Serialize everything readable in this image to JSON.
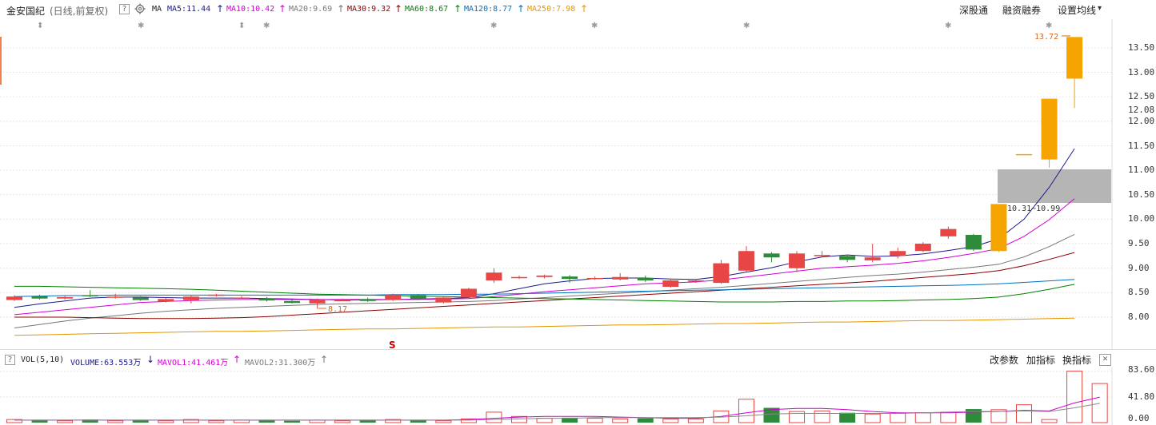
{
  "header": {
    "stock_name": "金安国纪",
    "period_label": "(日线,前复权)",
    "help_icon": "?",
    "settings_icon": "gear-icon",
    "ma_label": "MA",
    "ma_items": [
      {
        "label": "MA5:11.44",
        "arrow": "↑",
        "color": "#1a1a8c"
      },
      {
        "label": "MA10:10.42",
        "arrow": "↑",
        "color": "#d100d1"
      },
      {
        "label": "MA20:9.69",
        "arrow": "↑",
        "color": "#777777"
      },
      {
        "label": "MA30:9.32",
        "arrow": "↑",
        "color": "#8b0000"
      },
      {
        "label": "MA60:8.67",
        "arrow": "↑",
        "color": "#008000"
      },
      {
        "label": "MA120:8.77",
        "arrow": "↑",
        "color": "#0070c0"
      },
      {
        "label": "MA250:7.98",
        "arrow": "↑",
        "color": "#e69500"
      }
    ],
    "buttons": [
      "深股通",
      "融资融券",
      "设置均线"
    ],
    "settings_dropdown_arrow": "▾"
  },
  "price_axis": {
    "ticks": [
      "13.50",
      "13.00",
      "12.50",
      "12.00",
      "11.50",
      "11.00",
      "10.50",
      "10.00",
      "9.50",
      "9.00",
      "8.50",
      "8.00"
    ],
    "current": "12.08"
  },
  "annotations": {
    "high_label": "13.72",
    "low_label": "8.17",
    "gap_label": "10.31~10.99",
    "s_marker": "S"
  },
  "volume_header": {
    "help_icon": "?",
    "vol_label": "VOL(5,10)",
    "volume_value": "VOLUME:63.553万",
    "volume_arrow": "↓",
    "mavol1": "MAVOL1:41.461万",
    "mavol1_arrow": "↑",
    "mavol2": "MAVOL2:31.300万",
    "mavol2_arrow": "↑",
    "buttons": [
      "改参数",
      "加指标",
      "换指标"
    ],
    "close_icon": "✕"
  },
  "volume_axis": {
    "ticks": [
      "83.60",
      "41.80",
      "0.00"
    ]
  },
  "chart_data": {
    "type": "candlestick",
    "price_range": [
      7.6,
      13.9
    ],
    "candles": [
      {
        "o": 8.35,
        "c": 8.42,
        "h": 8.45,
        "l": 8.33
      },
      {
        "o": 8.43,
        "c": 8.38,
        "h": 8.46,
        "l": 8.36
      },
      {
        "o": 8.38,
        "c": 8.41,
        "h": 8.43,
        "l": 8.36
      },
      {
        "o": 8.45,
        "c": 8.43,
        "h": 8.55,
        "l": 8.41
      },
      {
        "o": 8.42,
        "c": 8.42,
        "h": 8.48,
        "l": 8.38
      },
      {
        "o": 8.4,
        "c": 8.35,
        "h": 8.43,
        "l": 8.33
      },
      {
        "o": 8.32,
        "c": 8.37,
        "h": 8.4,
        "l": 8.3
      },
      {
        "o": 8.35,
        "c": 8.42,
        "h": 8.44,
        "l": 8.28
      },
      {
        "o": 8.44,
        "c": 8.46,
        "h": 8.48,
        "l": 8.42
      },
      {
        "o": 8.4,
        "c": 8.4,
        "h": 8.43,
        "l": 8.38
      },
      {
        "o": 8.38,
        "c": 8.34,
        "h": 8.41,
        "l": 8.32
      },
      {
        "o": 8.33,
        "c": 8.29,
        "h": 8.36,
        "l": 8.28
      },
      {
        "o": 8.28,
        "c": 8.36,
        "h": 8.38,
        "l": 8.17
      },
      {
        "o": 8.35,
        "c": 8.35,
        "h": 8.38,
        "l": 8.33
      },
      {
        "o": 8.37,
        "c": 8.33,
        "h": 8.4,
        "l": 8.31
      },
      {
        "o": 8.36,
        "c": 8.46,
        "h": 8.48,
        "l": 8.33
      },
      {
        "o": 8.45,
        "c": 8.37,
        "h": 8.47,
        "l": 8.35
      },
      {
        "o": 8.3,
        "c": 8.4,
        "h": 8.42,
        "l": 8.28
      },
      {
        "o": 8.4,
        "c": 8.58,
        "h": 8.6,
        "l": 8.38
      },
      {
        "o": 8.75,
        "c": 8.91,
        "h": 9.0,
        "l": 8.7
      },
      {
        "o": 8.8,
        "c": 8.82,
        "h": 8.85,
        "l": 8.78
      },
      {
        "o": 8.82,
        "c": 8.85,
        "h": 8.87,
        "l": 8.79
      },
      {
        "o": 8.83,
        "c": 8.78,
        "h": 8.86,
        "l": 8.7
      },
      {
        "o": 8.78,
        "c": 8.8,
        "h": 8.83,
        "l": 8.76
      },
      {
        "o": 8.77,
        "c": 8.82,
        "h": 8.9,
        "l": 8.75
      },
      {
        "o": 8.8,
        "c": 8.75,
        "h": 8.85,
        "l": 8.72
      },
      {
        "o": 8.62,
        "c": 8.75,
        "h": 8.79,
        "l": 8.6
      },
      {
        "o": 8.75,
        "c": 8.75,
        "h": 8.78,
        "l": 8.7
      },
      {
        "o": 8.7,
        "c": 9.1,
        "h": 9.17,
        "l": 8.68
      },
      {
        "o": 8.95,
        "c": 9.35,
        "h": 9.45,
        "l": 8.92
      },
      {
        "o": 9.3,
        "c": 9.22,
        "h": 9.33,
        "l": 9.12
      },
      {
        "o": 9.0,
        "c": 9.3,
        "h": 9.35,
        "l": 8.92
      },
      {
        "o": 9.27,
        "c": 9.27,
        "h": 9.35,
        "l": 9.22
      },
      {
        "o": 9.25,
        "c": 9.17,
        "h": 9.28,
        "l": 9.12
      },
      {
        "o": 9.16,
        "c": 9.22,
        "h": 9.5,
        "l": 9.12
      },
      {
        "o": 9.25,
        "c": 9.35,
        "h": 9.42,
        "l": 9.2
      },
      {
        "o": 9.35,
        "c": 9.5,
        "h": 9.53,
        "l": 9.33
      },
      {
        "o": 9.65,
        "c": 9.8,
        "h": 9.85,
        "l": 9.6
      },
      {
        "o": 9.68,
        "c": 9.38,
        "h": 9.7,
        "l": 9.35
      },
      {
        "o": 9.35,
        "c": 10.31,
        "h": 10.31,
        "l": 9.33
      },
      {
        "o": 11.33,
        "c": 11.33,
        "h": 11.33,
        "l": 11.33
      },
      {
        "o": 11.22,
        "c": 12.46,
        "h": 12.46,
        "l": 11.05
      },
      {
        "o": 12.87,
        "c": 13.72,
        "h": 13.72,
        "l": 12.27
      }
    ],
    "moving_averages": [
      {
        "name": "MA5",
        "color": "#1a1a8c",
        "values": [
          8.2,
          8.27,
          8.33,
          8.39,
          8.41,
          8.41,
          8.4,
          8.39,
          8.39,
          8.39,
          8.38,
          8.37,
          8.36,
          8.35,
          8.35,
          8.36,
          8.37,
          8.38,
          8.4,
          8.48,
          8.58,
          8.68,
          8.74,
          8.79,
          8.8,
          8.8,
          8.78,
          8.77,
          8.83,
          8.92,
          9.01,
          9.13,
          9.23,
          9.27,
          9.24,
          9.25,
          9.29,
          9.36,
          9.44,
          9.6,
          10.0,
          10.65,
          11.44
        ]
      },
      {
        "name": "MA10",
        "color": "#d100d1",
        "values": [
          8.05,
          8.1,
          8.15,
          8.2,
          8.25,
          8.3,
          8.32,
          8.34,
          8.35,
          8.36,
          8.36,
          8.36,
          8.36,
          8.36,
          8.36,
          8.36,
          8.36,
          8.37,
          8.38,
          8.42,
          8.47,
          8.52,
          8.56,
          8.6,
          8.64,
          8.68,
          8.7,
          8.72,
          8.76,
          8.82,
          8.88,
          8.94,
          9.0,
          9.03,
          9.06,
          9.1,
          9.15,
          9.22,
          9.3,
          9.4,
          9.65,
          9.99,
          10.42
        ]
      },
      {
        "name": "MA20",
        "color": "#777777",
        "values": [
          7.78,
          7.85,
          7.92,
          7.98,
          8.03,
          8.08,
          8.12,
          8.15,
          8.18,
          8.2,
          8.22,
          8.24,
          8.26,
          8.27,
          8.28,
          8.29,
          8.3,
          8.31,
          8.32,
          8.34,
          8.37,
          8.4,
          8.43,
          8.46,
          8.49,
          8.52,
          8.55,
          8.58,
          8.61,
          8.65,
          8.69,
          8.73,
          8.77,
          8.81,
          8.85,
          8.88,
          8.92,
          8.97,
          9.02,
          9.08,
          9.23,
          9.44,
          9.69
        ]
      },
      {
        "name": "MA30",
        "color": "#8b0000",
        "values": [
          8.0,
          8.0,
          8.0,
          7.99,
          7.98,
          7.97,
          7.97,
          7.97,
          7.98,
          7.99,
          8.01,
          8.04,
          8.07,
          8.1,
          8.13,
          8.16,
          8.19,
          8.22,
          8.25,
          8.28,
          8.31,
          8.34,
          8.37,
          8.4,
          8.43,
          8.46,
          8.49,
          8.52,
          8.55,
          8.58,
          8.61,
          8.64,
          8.67,
          8.7,
          8.73,
          8.77,
          8.81,
          8.85,
          8.89,
          8.95,
          9.05,
          9.18,
          9.32
        ]
      },
      {
        "name": "MA60",
        "color": "#008000",
        "values": [
          8.63,
          8.63,
          8.62,
          8.61,
          8.6,
          8.59,
          8.58,
          8.57,
          8.55,
          8.53,
          8.51,
          8.49,
          8.47,
          8.46,
          8.45,
          8.44,
          8.43,
          8.42,
          8.41,
          8.4,
          8.39,
          8.38,
          8.37,
          8.36,
          8.35,
          8.34,
          8.33,
          8.32,
          8.31,
          8.31,
          8.31,
          8.32,
          8.32,
          8.33,
          8.33,
          8.34,
          8.35,
          8.36,
          8.38,
          8.41,
          8.48,
          8.57,
          8.67
        ]
      },
      {
        "name": "MA120",
        "color": "#0070c0",
        "values": [
          8.42,
          8.43,
          8.44,
          8.44,
          8.45,
          8.45,
          8.45,
          8.45,
          8.45,
          8.45,
          8.45,
          8.45,
          8.45,
          8.45,
          8.45,
          8.46,
          8.46,
          8.46,
          8.47,
          8.47,
          8.48,
          8.49,
          8.5,
          8.51,
          8.52,
          8.53,
          8.54,
          8.55,
          8.56,
          8.57,
          8.58,
          8.59,
          8.6,
          8.61,
          8.62,
          8.63,
          8.64,
          8.65,
          8.66,
          8.68,
          8.71,
          8.74,
          8.77
        ]
      },
      {
        "name": "MA250",
        "color": "#e69500",
        "values": [
          7.63,
          7.64,
          7.65,
          7.66,
          7.67,
          7.68,
          7.69,
          7.7,
          7.71,
          7.71,
          7.72,
          7.73,
          7.74,
          7.75,
          7.76,
          7.76,
          7.77,
          7.78,
          7.79,
          7.8,
          7.8,
          7.81,
          7.82,
          7.83,
          7.84,
          7.84,
          7.85,
          7.86,
          7.87,
          7.87,
          7.88,
          7.89,
          7.9,
          7.9,
          7.91,
          7.92,
          7.93,
          7.93,
          7.94,
          7.95,
          7.96,
          7.97,
          7.98
        ]
      }
    ],
    "volume_range": [
      0,
      83.6
    ],
    "volumes": [
      5,
      4,
      3,
      5,
      3,
      4,
      3,
      5,
      3,
      4,
      4,
      3,
      4,
      3,
      4,
      5,
      4,
      3,
      6,
      17,
      10,
      7,
      8,
      7,
      6,
      7,
      6,
      6,
      19,
      38,
      24,
      18,
      19,
      16,
      14,
      15,
      16,
      17,
      22,
      21,
      29,
      5,
      83.6,
      63.553
    ],
    "mavol1": [
      4,
      4,
      4,
      4,
      4,
      4,
      4,
      4,
      4,
      4,
      4,
      4,
      4,
      4,
      4,
      4,
      4,
      4,
      5,
      7,
      9,
      10,
      10,
      10,
      9,
      8,
      7,
      7,
      10,
      16,
      21,
      23,
      23,
      21,
      18,
      16,
      16,
      16,
      17,
      18,
      20,
      19,
      32,
      41.461
    ],
    "mavol2": [
      4,
      4,
      4,
      4,
      4,
      4,
      4,
      4,
      4,
      4,
      4,
      4,
      4,
      4,
      4,
      4,
      4,
      4,
      4,
      5,
      6,
      7,
      7,
      8,
      8,
      8,
      8,
      8,
      9,
      11,
      14,
      15,
      15,
      15,
      15,
      15,
      16,
      17,
      18,
      18,
      19,
      18,
      24,
      31.3
    ]
  }
}
